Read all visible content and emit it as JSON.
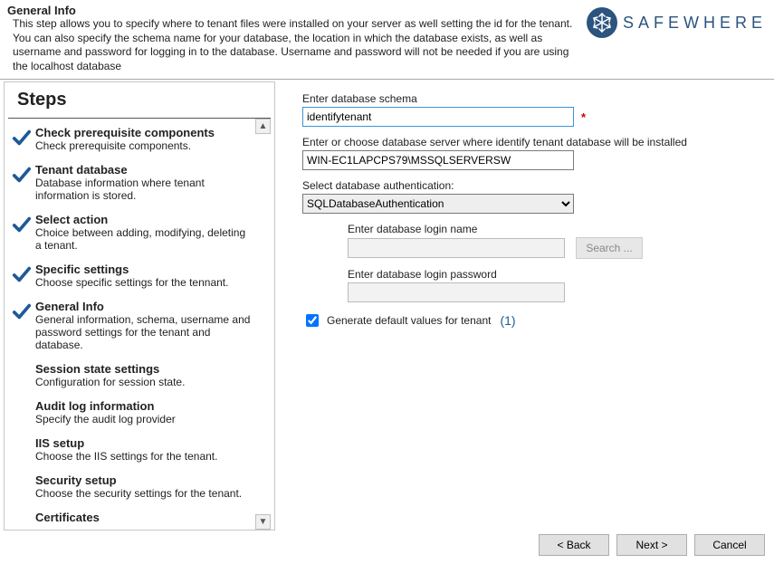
{
  "header": {
    "title": "General Info",
    "description": "This step allows you to specify where to tenant files were installed on your server as well setting the id for the tenant. You can also specify the schema name for your database, the location in which the database exists, as well as username and password for logging in to the database. Username and password will not be needed if you are using the localhost database"
  },
  "brand": {
    "text": "SAFEWHERE"
  },
  "steps": {
    "heading": "Steps",
    "items": [
      {
        "title": "Check prerequisite components",
        "subtitle": "Check prerequisite components.",
        "checked": true
      },
      {
        "title": "Tenant database",
        "subtitle": "Database information where tenant information is stored.",
        "checked": true
      },
      {
        "title": "Select action",
        "subtitle": "Choice between adding, modifying, deleting a tenant.",
        "checked": true
      },
      {
        "title": "Specific settings",
        "subtitle": "Choose specific settings for the tennant.",
        "checked": true
      },
      {
        "title": "General Info",
        "subtitle": "General information, schema, username and password settings for the tenant and database.",
        "checked": true
      },
      {
        "title": "Session state settings",
        "subtitle": "Configuration for session state.",
        "checked": false
      },
      {
        "title": "Audit log information",
        "subtitle": "Specify the audit log provider",
        "checked": false
      },
      {
        "title": "IIS setup",
        "subtitle": "Choose the IIS settings for the tenant.",
        "checked": false
      },
      {
        "title": "Security setup",
        "subtitle": "Choose the security settings for the tenant.",
        "checked": false
      },
      {
        "title": "Certificates",
        "subtitle": "",
        "checked": false
      }
    ]
  },
  "form": {
    "schemaLabel": "Enter database schema",
    "schemaValue": "identifytenant",
    "serverLabel": "Enter or choose database server where identify tenant database will be installed",
    "serverValue": "WIN-EC1LAPCPS79\\MSSQLSERVERSW",
    "authLabel": "Select database authentication:",
    "authValue": "SQLDatabaseAuthentication",
    "loginLabel": "Enter database login name",
    "loginValue": "",
    "passwordLabel": "Enter database login password",
    "passwordValue": "",
    "searchBtn": "Search ...",
    "checkboxLabel": "Generate default values for tenant",
    "checkboxChecked": true,
    "annotation": "(1)"
  },
  "footer": {
    "back": "< Back",
    "next": "Next >",
    "cancel": "Cancel"
  }
}
